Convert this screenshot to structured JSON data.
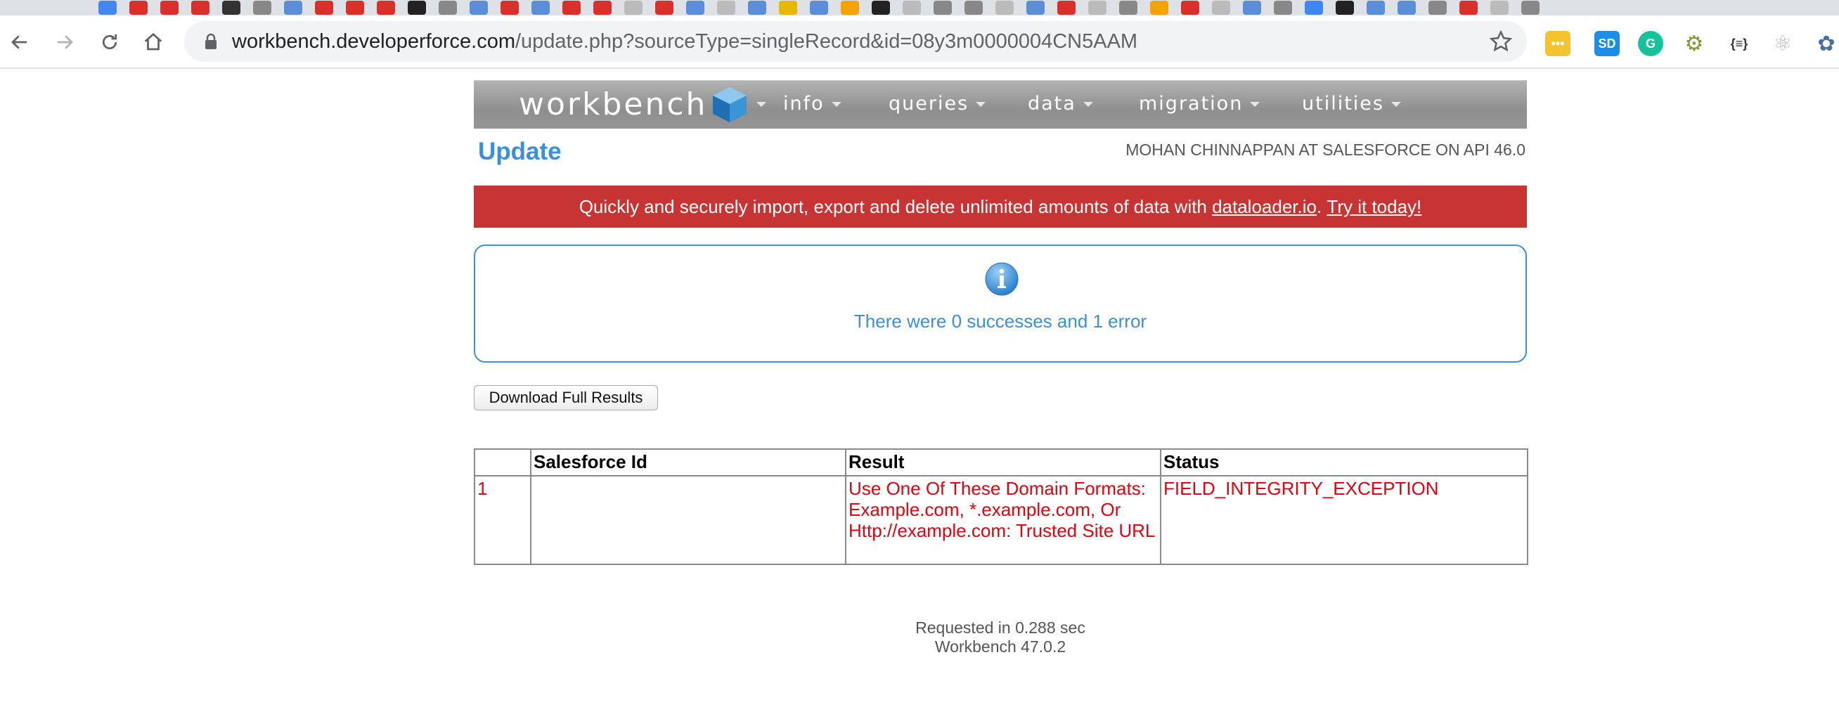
{
  "browser": {
    "url_host": "workbench.developerforce.com",
    "url_path": "/update.php?sourceType=singleRecord&id=08y3m0000004CN5AAM",
    "extensions": [
      {
        "name": "dots-ext-icon",
        "glyph": "•••",
        "color": "#f4c430"
      },
      {
        "name": "salesforce-sd-ext-icon",
        "glyph": "SD",
        "color": "#1b8ee8"
      },
      {
        "name": "grammarly-ext-icon",
        "glyph": "G",
        "color": "#15c39a"
      },
      {
        "name": "cog-bike-ext-icon",
        "glyph": "⚙",
        "color": "#7a9a2a"
      },
      {
        "name": "json-ext-icon",
        "glyph": "{≡}",
        "color": "#333333"
      },
      {
        "name": "react-ext-icon",
        "glyph": "⚛",
        "color": "#bbbbbb"
      },
      {
        "name": "gear-ext-icon",
        "glyph": "✿",
        "color": "#4a6fa5"
      }
    ]
  },
  "header": {
    "logo_text": "workbench",
    "menus": [
      "info",
      "queries",
      "data",
      "migration",
      "utilities"
    ]
  },
  "page": {
    "title": "Update",
    "user_info": "MOHAN CHINNAPPAN AT SALESFORCE ON API 46.0"
  },
  "promo": {
    "text_before": "Quickly and securely import, export and delete unlimited amounts of data with ",
    "link1": "dataloader.io",
    "text_between": ". ",
    "link2": "Try it today!"
  },
  "info": {
    "message": "There were 0 successes and 1 error"
  },
  "actions": {
    "download_label": "Download Full Results"
  },
  "table": {
    "headers": [
      "",
      "Salesforce Id",
      "Result",
      "Status"
    ],
    "rows": [
      {
        "num": "1",
        "salesforce_id": "",
        "result": "Use One Of These Domain Formats: Example.com, *.example.com, Or Http://example.com: Trusted Site URL",
        "status": "FIELD_INTEGRITY_EXCEPTION"
      }
    ]
  },
  "footer": {
    "requested": "Requested in 0.288 sec",
    "version": "Workbench 47.0.2"
  }
}
